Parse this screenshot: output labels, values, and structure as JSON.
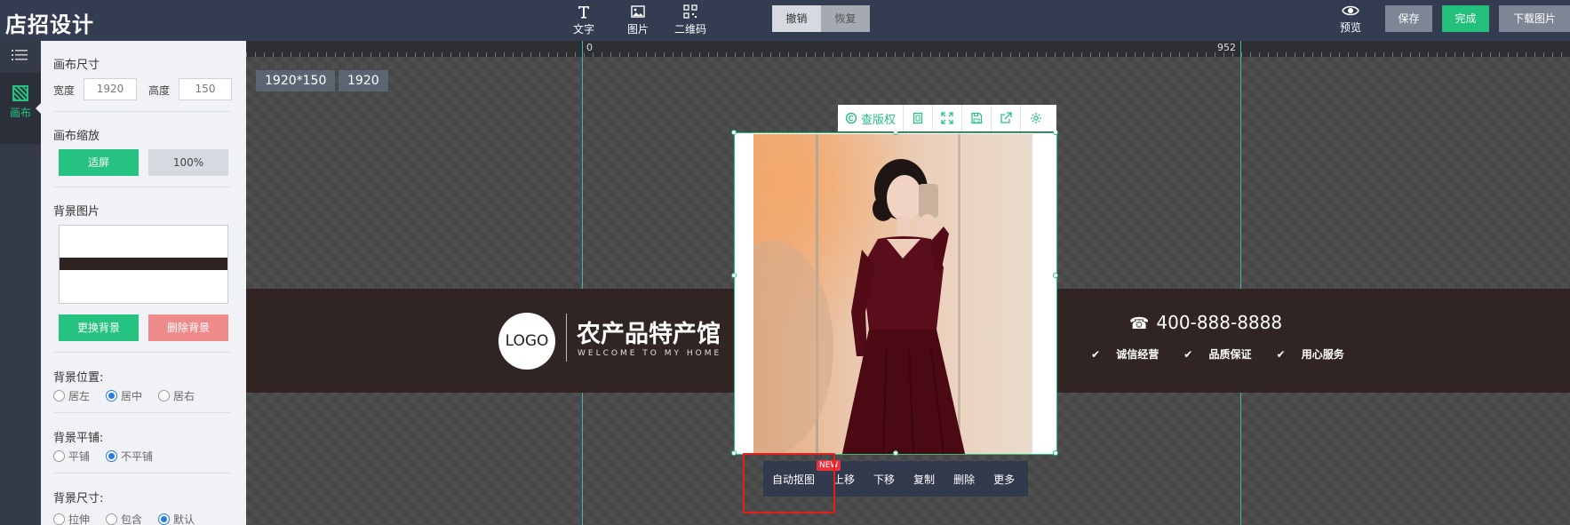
{
  "app": {
    "title": "店招设计"
  },
  "toolbar": {
    "tools": [
      {
        "label": "文字",
        "icon": "text-icon"
      },
      {
        "label": "图片",
        "icon": "image-icon"
      },
      {
        "label": "二维码",
        "icon": "qrcode-icon"
      }
    ],
    "undo_label": "撤销",
    "redo_label": "恢复",
    "preview_label": "预览",
    "save_label": "保存",
    "done_label": "完成",
    "download_label": "下载图片"
  },
  "sidebar": {
    "canvas_tab_label": "画布"
  },
  "panel": {
    "canvas_size": {
      "title": "画布尺寸",
      "width_label": "宽度",
      "width_value": "1920",
      "height_label": "高度",
      "height_value": "150"
    },
    "canvas_zoom": {
      "title": "画布缩放",
      "fit_label": "适屏",
      "actual_label": "100%"
    },
    "background_image": {
      "title": "背景图片",
      "change_label": "更换背景",
      "delete_label": "删除背景"
    },
    "bg_position": {
      "title": "背景位置:",
      "options": [
        "居左",
        "居中",
        "居右"
      ],
      "selected": "居中"
    },
    "bg_tile": {
      "title": "背景平铺:",
      "options": [
        "平铺",
        "不平铺"
      ],
      "selected": "不平铺"
    },
    "bg_size": {
      "title": "背景尺寸:",
      "options": [
        "拉伸",
        "包含",
        "默认"
      ],
      "selected": "默认"
    }
  },
  "workspace": {
    "ruler_start": "0",
    "ruler_mid": "952",
    "size_tag": "1920*150",
    "width_tag": "1920",
    "banner": {
      "logo_text": "LOGO",
      "store_name": "农产品特产馆",
      "store_subtitle": "WELCOME TO MY HOME",
      "phone": "400-888-8888",
      "badges": [
        "诚信经营",
        "品质保证",
        "用心服务"
      ]
    },
    "image_toolbar": {
      "copyright_label": "查版权"
    },
    "context_menu": {
      "items": [
        "自动抠图",
        "上移",
        "下移",
        "复制",
        "删除",
        "更多"
      ],
      "new_badge": "NEW"
    }
  },
  "colors": {
    "accent": "#26c281",
    "topbar": "#343c52",
    "banner": "#302523",
    "highlight": "#e3201b"
  }
}
